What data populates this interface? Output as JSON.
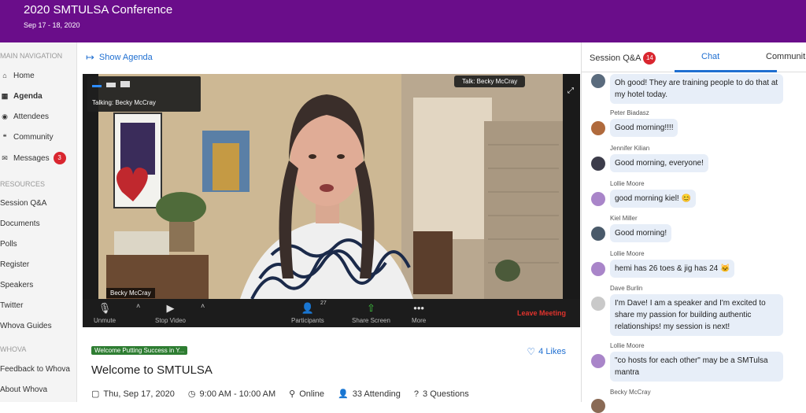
{
  "header": {
    "title": "2020 SMTULSA Conference",
    "dates": "Sep 17 - 18, 2020",
    "bg": "#6a0d8a"
  },
  "sidebar": {
    "main_nav_label": "MAIN NAVIGATION",
    "items": [
      {
        "label": "Home",
        "icon": "home-icon",
        "glyph": "⌂"
      },
      {
        "label": "Agenda",
        "icon": "calendar-icon",
        "glyph": "▦"
      },
      {
        "label": "Attendees",
        "icon": "people-icon",
        "glyph": "👥"
      },
      {
        "label": "Community",
        "icon": "chat-bubbles-icon",
        "glyph": "💬"
      },
      {
        "label": "Messages",
        "icon": "envelope-icon",
        "glyph": "✉",
        "badge": "3"
      }
    ],
    "resources_label": "RESOURCES",
    "resources": [
      "Session Q&A",
      "Documents",
      "Polls",
      "Register",
      "Speakers",
      "Twitter",
      "Whova Guides"
    ],
    "whova_label": "WHOVA",
    "whova_items": [
      "Feedback to Whova",
      "About Whova"
    ]
  },
  "main": {
    "show_agenda": "Show Agenda",
    "video": {
      "talking": "Talking: Becky McCray",
      "talk_label": "Talk: Becky McCray",
      "name_tag": "Becky McCray",
      "controls": {
        "unmute": "Unmute",
        "stop_video": "Stop Video",
        "participants": "Participants",
        "participants_count": "27",
        "share_screen": "Share Screen",
        "more": "More",
        "leave": "Leave Meeting"
      }
    },
    "tag": "Welcome Putting Success in Y...",
    "likes": "4 Likes",
    "session_title": "Welcome to SMTULSA",
    "meta": {
      "date": "Thu, Sep 17, 2020",
      "time": "9:00 AM - 10:00 AM",
      "location": "Online",
      "attending": "33 Attending",
      "questions": "3 Questions"
    }
  },
  "right": {
    "tabs": {
      "qa": "Session Q&A",
      "qa_badge": "14",
      "chat": "Chat",
      "community": "Communit"
    },
    "messages": [
      {
        "author": "",
        "text": "Oh good! They are training people to do that at my hotel today.",
        "avatar": "#5a6b7d"
      },
      {
        "author": "Peter Biadasz",
        "text": "Good morning!!!!",
        "avatar": "#b06a3c"
      },
      {
        "author": "Jennifer Kilian",
        "text": "Good morning, everyone!",
        "avatar": "#3c3c4a"
      },
      {
        "author": "Lollie Moore",
        "text": "good morning kiel! 😊",
        "avatar": "#a985c9"
      },
      {
        "author": "Kiel Miller",
        "text": "Good morning!",
        "avatar": "#4a5a6a"
      },
      {
        "author": "Lollie Moore",
        "text": "hemi has 26 toes & jig has 24 🐱",
        "avatar": "#a985c9"
      },
      {
        "author": "Dave Burlin",
        "text": "I'm Dave! I am a speaker and I'm excited to share my passion for building authentic relationships! my session is next!",
        "avatar": "#c9c9c9"
      },
      {
        "author": "Lollie Moore",
        "text": "\"co hosts for each other\" may be a SMTulsa mantra",
        "avatar": "#a985c9"
      },
      {
        "author": "Becky McCray",
        "text": "",
        "avatar": "#8a6a55"
      }
    ]
  }
}
